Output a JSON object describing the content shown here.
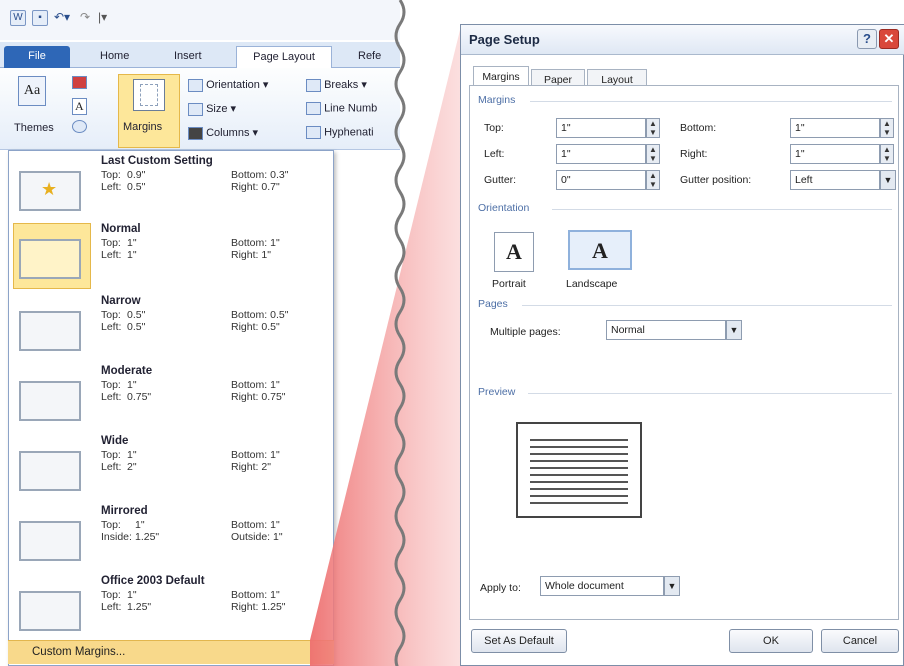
{
  "word": {
    "qat_icons": [
      "word-logo-icon",
      "save-icon",
      "undo-icon",
      "redo-icon",
      "customize-icon"
    ],
    "qat_logo": "W",
    "tabs": [
      {
        "label": "File"
      },
      {
        "label": "Home"
      },
      {
        "label": "Insert"
      },
      {
        "label": "Page Layout"
      },
      {
        "label": "Refe"
      }
    ],
    "ribbon": {
      "themes_label": "Themes",
      "margins_label": "Margins",
      "orientation_label": "Orientation ▾",
      "size_label": "Size ▾",
      "columns_label": "Columns ▾",
      "breaks_label": "Breaks ▾",
      "line_numbers_label": "Line Numb",
      "hyphenation_label": "Hyphenati"
    },
    "margins_menu": [
      {
        "title": "Last Custom Setting",
        "top_label": "Top:",
        "top": "0.9\"",
        "bottom_label": "Bottom:",
        "bottom": "0.3\"",
        "left_label": "Left:",
        "left": "0.5\"",
        "right_label": "Right:",
        "right": "0.7\""
      },
      {
        "title": "Normal",
        "top_label": "Top:",
        "top": "1\"",
        "bottom_label": "Bottom:",
        "bottom": "1\"",
        "left_label": "Left:",
        "left": "1\"",
        "right_label": "Right:",
        "right": "1\""
      },
      {
        "title": "Narrow",
        "top_label": "Top:",
        "top": "0.5\"",
        "bottom_label": "Bottom:",
        "bottom": "0.5\"",
        "left_label": "Left:",
        "left": "0.5\"",
        "right_label": "Right:",
        "right": "0.5\""
      },
      {
        "title": "Moderate",
        "top_label": "Top:",
        "top": "1\"",
        "bottom_label": "Bottom:",
        "bottom": "1\"",
        "left_label": "Left:",
        "left": "0.75\"",
        "right_label": "Right:",
        "right": "0.75\""
      },
      {
        "title": "Wide",
        "top_label": "Top:",
        "top": "1\"",
        "bottom_label": "Bottom:",
        "bottom": "1\"",
        "left_label": "Left:",
        "left": "2\"",
        "right_label": "Right:",
        "right": "2\""
      },
      {
        "title": "Mirrored",
        "top_label": "Top:",
        "top": "1\"",
        "bottom_label": "Bottom:",
        "bottom": "1\"",
        "left_label": "Inside:",
        "left": "1.25\"",
        "right_label": "Outside:",
        "right": "1\""
      },
      {
        "title": "Office 2003 Default",
        "top_label": "Top:",
        "top": "1\"",
        "bottom_label": "Bottom:",
        "bottom": "1\"",
        "left_label": "Left:",
        "left": "1.25\"",
        "right_label": "Right:",
        "right": "1.25\""
      }
    ],
    "custom_margins_label": "Custom Margins..."
  },
  "dialog": {
    "title": "Page Setup",
    "help_btn": "?",
    "close_btn": "✕",
    "tabs": [
      "Margins",
      "Paper",
      "Layout"
    ],
    "margins_section": "Margins",
    "top_label": "Top:",
    "top_value": "1\"",
    "bottom_label": "Bottom:",
    "bottom_value": "1\"",
    "left_label": "Left:",
    "left_value": "1\"",
    "right_label": "Right:",
    "right_value": "1\"",
    "gutter_label": "Gutter:",
    "gutter_value": "0\"",
    "gutter_position_label": "Gutter position:",
    "gutter_position_value": "Left",
    "orientation_section": "Orientation",
    "portrait_label": "Portrait",
    "landscape_label": "Landscape",
    "orientation_glyph": "A",
    "pages_section": "Pages",
    "multiple_pages_label": "Multiple pages:",
    "multiple_pages_value": "Normal",
    "preview_section": "Preview",
    "apply_to_label": "Apply to:",
    "apply_to_value": "Whole document",
    "set_default_label": "Set As Default",
    "ok_label": "OK",
    "cancel_label": "Cancel"
  },
  "colors": {
    "accent": "#2e67b7",
    "highlight": "#fde79a",
    "wedge": "#ee7070"
  }
}
